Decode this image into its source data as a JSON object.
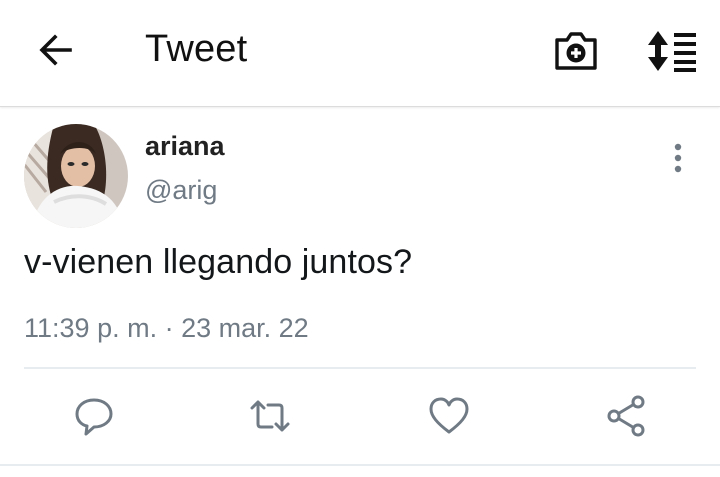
{
  "header": {
    "title": "Tweet",
    "back_icon": "arrow-left-icon",
    "camera_icon": "camera-add-icon",
    "reorder_icon": "sort-order-icon"
  },
  "tweet": {
    "author_name": "ariana",
    "author_handle": "@arig",
    "text": "v-vienen llegando juntos?",
    "timestamp": "11:39 p. m. · 23 mar. 22",
    "more_icon": "more-vertical-icon"
  },
  "actions": [
    {
      "name": "reply",
      "icon": "reply-icon"
    },
    {
      "name": "retweet",
      "icon": "retweet-icon"
    },
    {
      "name": "like",
      "icon": "heart-icon"
    },
    {
      "name": "share",
      "icon": "share-icon"
    }
  ],
  "colors": {
    "text_primary": "#14171a",
    "text_secondary": "#6f7a85",
    "icon_gray": "#6f7a85",
    "divider": "#e6ecf0"
  }
}
